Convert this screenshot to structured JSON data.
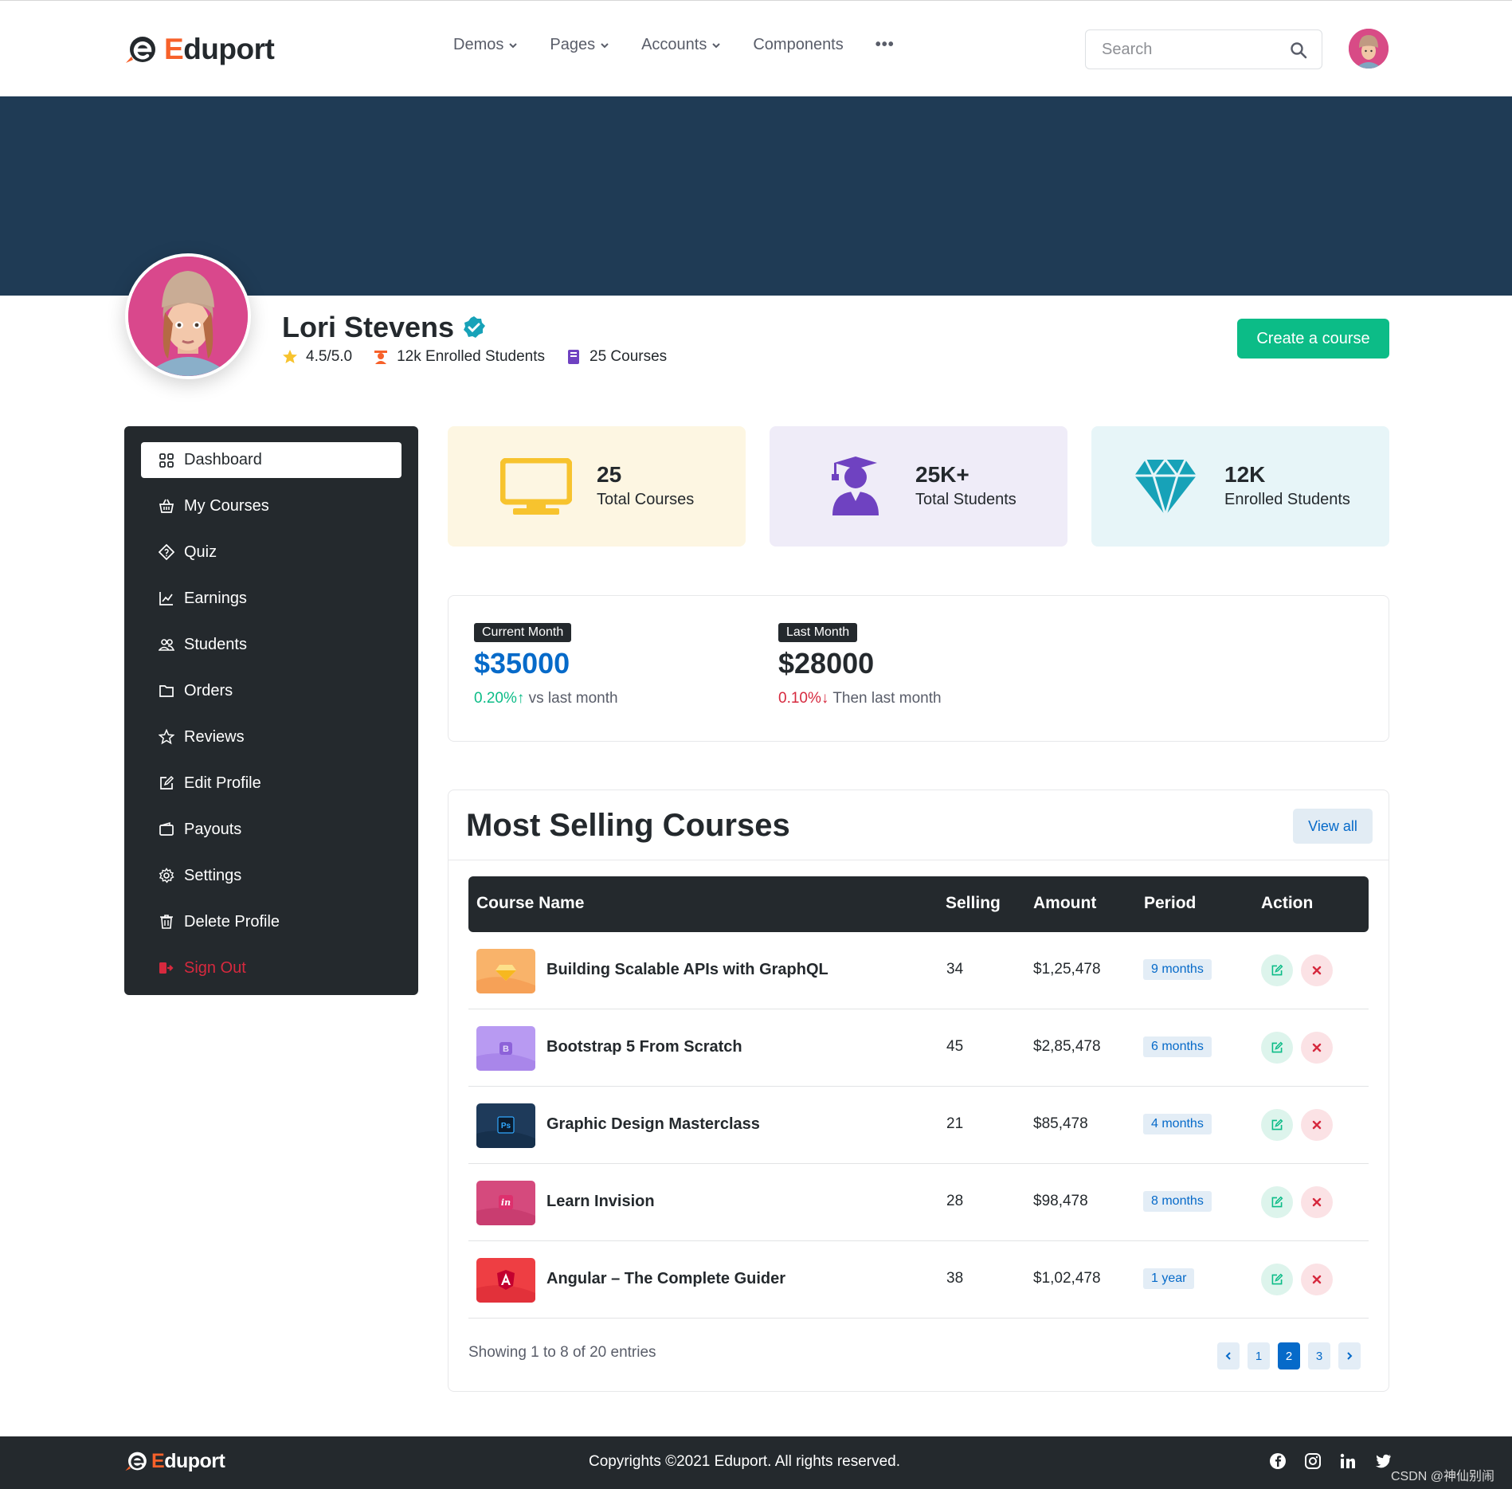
{
  "header": {
    "brand": {
      "first": "E",
      "rest": "duport"
    },
    "nav": [
      {
        "label": "Demos",
        "caret": true
      },
      {
        "label": "Pages",
        "caret": true
      },
      {
        "label": "Accounts",
        "caret": true
      },
      {
        "label": "Components",
        "caret": false
      }
    ],
    "more": "•••",
    "search_placeholder": "Search"
  },
  "profile": {
    "name": "Lori Stevens",
    "rating": "4.5/5.0",
    "enrolled": "12k Enrolled Students",
    "courses": "25 Courses",
    "create_button": "Create a course"
  },
  "sidebar": {
    "items": [
      {
        "label": "Dashboard",
        "icon": "grid-icon",
        "active": true
      },
      {
        "label": "My Courses",
        "icon": "basket-icon"
      },
      {
        "label": "Quiz",
        "icon": "patch-question-icon"
      },
      {
        "label": "Earnings",
        "icon": "graph-up-icon"
      },
      {
        "label": "Students",
        "icon": "people-icon"
      },
      {
        "label": "Orders",
        "icon": "folder-icon"
      },
      {
        "label": "Reviews",
        "icon": "star-icon"
      },
      {
        "label": "Edit Profile",
        "icon": "pencil-square-icon"
      },
      {
        "label": "Payouts",
        "icon": "wallet-icon"
      },
      {
        "label": "Settings",
        "icon": "gear-icon"
      },
      {
        "label": "Delete Profile",
        "icon": "trash-icon"
      },
      {
        "label": "Sign Out",
        "icon": "sign-out-icon",
        "danger": true
      }
    ]
  },
  "stats": [
    {
      "value": "25",
      "label": "Total Courses",
      "icon": "tv-icon",
      "bg": "#fdf6e2",
      "color": "#f7c32e"
    },
    {
      "value": "25K+",
      "label": "Total Students",
      "icon": "graduate-icon",
      "bg": "#efecf8",
      "color": "#6f42c1"
    },
    {
      "value": "12K",
      "label": "Enrolled Students",
      "icon": "gem-icon",
      "bg": "#e7f5f8",
      "color": "#17a2b8"
    }
  ],
  "earnings": {
    "current": {
      "badge": "Current Month",
      "amount": "$35000",
      "change": "0.20%",
      "arrow": "↑",
      "note": "vs last month"
    },
    "last": {
      "badge": "Last Month",
      "amount": "$28000",
      "change": "0.10%",
      "arrow": "↓",
      "note": "Then last month"
    }
  },
  "courses": {
    "title": "Most Selling Courses",
    "view_all": "View all",
    "columns": [
      "Course Name",
      "Selling",
      "Amount",
      "Period",
      "Action"
    ],
    "rows": [
      {
        "name": "Building Scalable APIs with GraphQL",
        "selling": "34",
        "amount": "$1,25,478",
        "period": "9 months",
        "thumb": "sketch"
      },
      {
        "name": "Bootstrap 5 From Scratch",
        "selling": "45",
        "amount": "$2,85,478",
        "period": "6 months",
        "thumb": "bootstrap"
      },
      {
        "name": "Graphic Design Masterclass",
        "selling": "21",
        "amount": "$85,478",
        "period": "4 months",
        "thumb": "photoshop"
      },
      {
        "name": "Learn Invision",
        "selling": "28",
        "amount": "$98,478",
        "period": "8 months",
        "thumb": "invision"
      },
      {
        "name": "Angular – The Complete Guider",
        "selling": "38",
        "amount": "$1,02,478",
        "period": "1 year",
        "thumb": "angular"
      }
    ],
    "showing": "Showing 1 to 8 of 20 entries",
    "pages": [
      "1",
      "2",
      "3"
    ],
    "active_page": "2"
  },
  "footer": {
    "brand": {
      "first": "E",
      "rest": "duport"
    },
    "copyright": "Copyrights ©2021 Eduport. All rights reserved.",
    "social": [
      "facebook-icon",
      "instagram-icon",
      "linkedin-icon",
      "twitter-icon"
    ],
    "watermark": "CSDN @神仙别闹"
  }
}
